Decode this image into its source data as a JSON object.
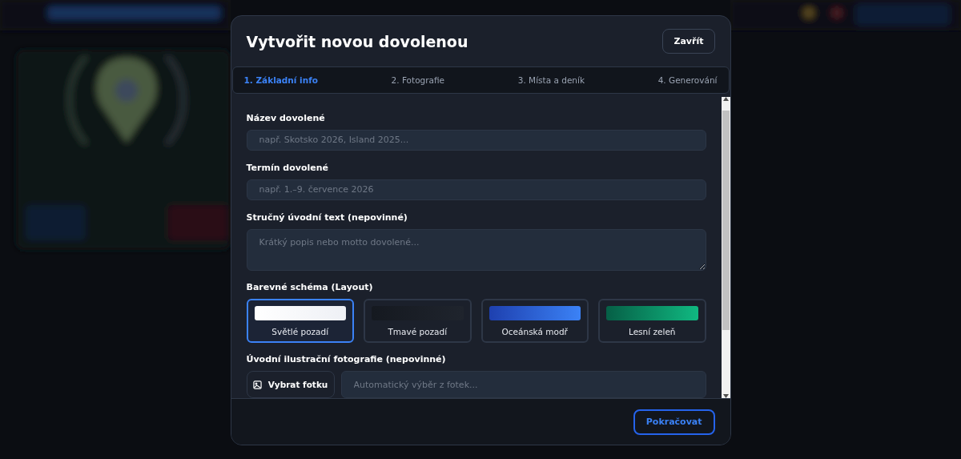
{
  "dialog": {
    "title": "Vytvořit novou dovolenou",
    "close_button": "Zavřít",
    "steps": [
      {
        "label": "1. Základní info",
        "selected": true
      },
      {
        "label": "2. Fotografie",
        "selected": false
      },
      {
        "label": "3. Místa a deník",
        "selected": false
      },
      {
        "label": "4. Generování",
        "selected": false
      }
    ],
    "fields": [
      {
        "label": "Název dovolené",
        "placeholder": "např. Skotsko 2026, Island 2025...",
        "kind": "input"
      },
      {
        "label": "Termín dovolené",
        "placeholder": "např. 1.–9. července 2026",
        "kind": "input"
      },
      {
        "label": "Stručný úvodní text (nepovinné)",
        "placeholder": "Krátký popis nebo motto dovolené...",
        "kind": "textarea"
      }
    ],
    "color_scheme": {
      "label": "Barevné schéma (Layout)",
      "options": [
        {
          "label": "Světlé pozadí",
          "kind": "light",
          "selected": true
        },
        {
          "label": "Tmavé pozadí",
          "kind": "dark",
          "selected": false
        },
        {
          "label": "Oceánská modř",
          "kind": "ocean",
          "selected": false
        },
        {
          "label": "Lesní zeleň",
          "kind": "forest",
          "selected": false
        }
      ]
    },
    "cover_photo": {
      "label": "Úvodní ilustrační fotografie (nepovinné)",
      "button": "Vybrat fotku",
      "placeholder": "Automatický výběr z fotek..."
    },
    "continue_button": "Pokračovat"
  }
}
